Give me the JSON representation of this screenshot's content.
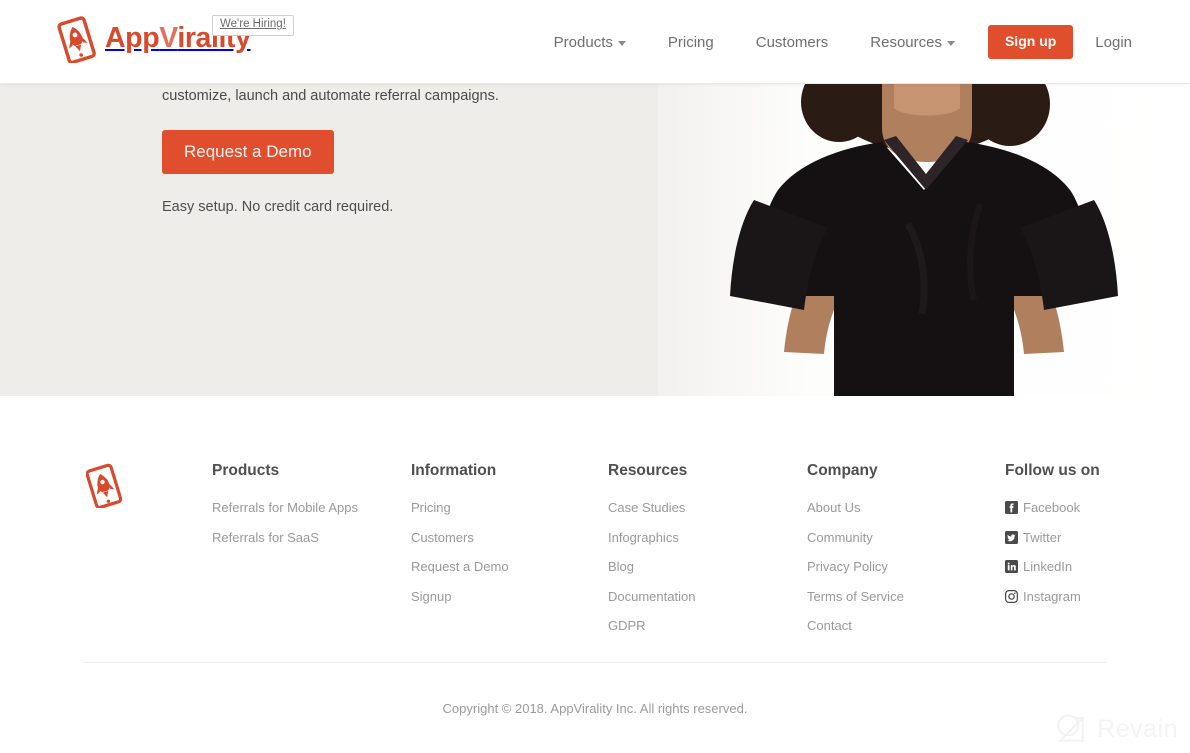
{
  "colors": {
    "accent": "#e04e2e",
    "hero_bg": "#efedea",
    "nav_text": "#6f6f6f",
    "footer_link": "#9a9a9a",
    "footer_heading": "#4f4f4f"
  },
  "header": {
    "brand": {
      "name_part1": "App",
      "name_part2": "V",
      "name_part3": "irality",
      "logo_icon": "rocket-phone-logo"
    },
    "hiring_badge": "We're Hiring!",
    "nav": [
      {
        "label": "Products",
        "has_caret": true
      },
      {
        "label": "Pricing",
        "has_caret": false
      },
      {
        "label": "Customers",
        "has_caret": false
      },
      {
        "label": "Resources",
        "has_caret": true
      }
    ],
    "signup_label": "Sign up",
    "login_label": "Login"
  },
  "hero": {
    "subtitle": "customize, launch and automate referral campaigns.",
    "cta_label": "Request a Demo",
    "note": "Easy setup. No credit card required.",
    "photo_alt": "woman-in-black-tshirt-photo"
  },
  "footer": {
    "logo_icon": "rocket-phone-logo",
    "columns": [
      {
        "title": "Products",
        "links": [
          "Referrals for Mobile Apps",
          "Referrals for SaaS"
        ]
      },
      {
        "title": "Information",
        "links": [
          "Pricing",
          "Customers",
          "Request a Demo",
          "Signup"
        ]
      },
      {
        "title": "Resources",
        "links": [
          "Case Studies",
          "Infographics",
          "Blog",
          "Documentation",
          "GDPR"
        ]
      },
      {
        "title": "Company",
        "links": [
          "About Us",
          "Community",
          "Privacy Policy",
          "Terms of Service",
          "Contact"
        ]
      }
    ],
    "social": {
      "title": "Follow us on",
      "links": [
        {
          "label": "Facebook",
          "icon": "facebook-icon"
        },
        {
          "label": "Twitter",
          "icon": "twitter-icon"
        },
        {
          "label": "LinkedIn",
          "icon": "linkedin-icon"
        },
        {
          "label": "Instagram",
          "icon": "instagram-icon"
        }
      ]
    },
    "copyright": "Copyright © 2018. AppVirality Inc. All rights reserved."
  },
  "watermark": {
    "text": "Revain",
    "icon": "revain-magnifier-logo"
  }
}
